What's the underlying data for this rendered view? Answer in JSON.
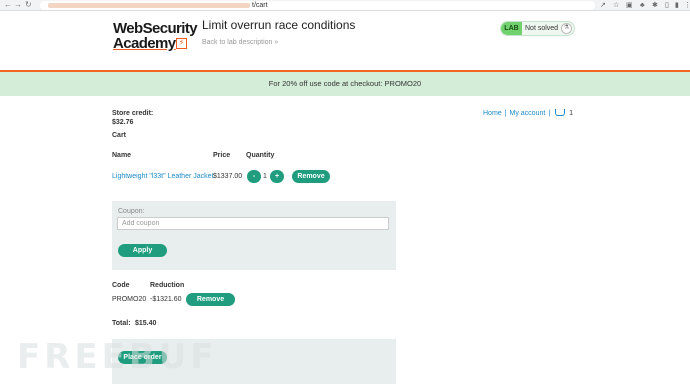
{
  "browser": {
    "url_suffix": "t/cart",
    "nav": {
      "back": "←",
      "forward": "→",
      "reload": "↻",
      "site": "⚠"
    },
    "extensions": [
      "↗",
      "☆",
      "▣",
      "♣",
      "✱",
      "▯",
      "▮",
      "⋮"
    ]
  },
  "lab": {
    "logo_line1": "WebSecurity",
    "logo_line2": "Academy",
    "logo_mark": "⚡",
    "title": "Limit overrun race conditions",
    "back_link": "Back to lab description",
    "back_chevrons": "»",
    "badge_tag": "LAB",
    "status": "Not solved",
    "flask_icon": "⚗"
  },
  "banner": {
    "text": "For 20% off use code at checkout: PROMO20"
  },
  "store": {
    "label": "Store credit:",
    "value": "$32.76"
  },
  "topnav": {
    "home": "Home",
    "separator": "|",
    "account": "My account",
    "cart_count": "1"
  },
  "cart": {
    "heading": "Cart",
    "columns": {
      "name": "Name",
      "price": "Price",
      "quantity": "Quantity"
    },
    "item": {
      "name": "Lightweight \"l33t\" Leather Jacket",
      "price": "$1337.00",
      "minus": "-",
      "quantity": "1",
      "plus": "+",
      "remove": "Remove"
    }
  },
  "coupon": {
    "label": "Coupon:",
    "placeholder": "Add coupon",
    "apply": "Apply"
  },
  "reductions": {
    "columns": {
      "code": "Code",
      "reduction": "Reduction"
    },
    "row": {
      "code": "PROMO20",
      "amount": "-$1321.60",
      "remove": "Remove"
    }
  },
  "total": {
    "label": "Total:",
    "value": "$15.40"
  },
  "order": {
    "button": "Place order"
  },
  "watermark": "FREEBUF",
  "colors": {
    "accent": "#1f9d7e",
    "link": "#1d8ac8",
    "brand_orange": "#f26522",
    "banner": "#d4edd9",
    "lab_green": "#70d16d"
  }
}
